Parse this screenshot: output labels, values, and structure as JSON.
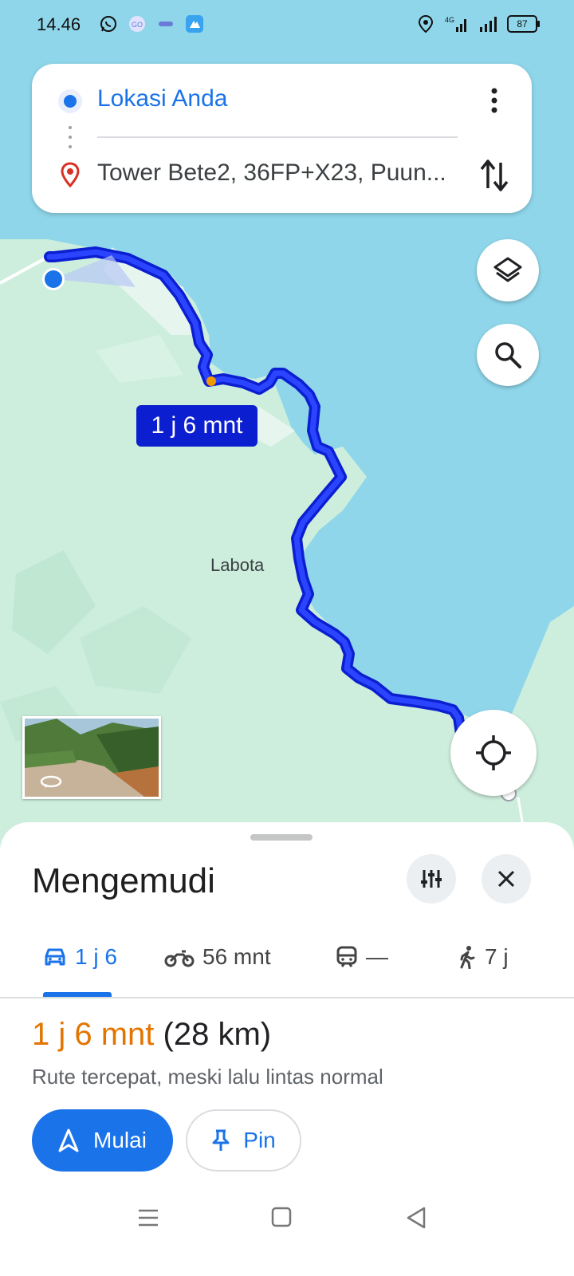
{
  "status_bar": {
    "time": "14.46",
    "battery": "87",
    "network": "4G",
    "left_icons": [
      "whatsapp-icon",
      "gojek-icon",
      "app-icon",
      "app-icon"
    ],
    "right_icons": [
      "location-icon",
      "signal-icon",
      "signal-icon",
      "battery-icon"
    ]
  },
  "directions": {
    "origin": "Lokasi Anda",
    "destination": "Tower Bete2, 36FP+X23, Puun..."
  },
  "map": {
    "route_time_label": "1 j 6 mnt",
    "place_label": "Labota",
    "colors": {
      "water": "#8fd6ea",
      "land": "#cdeedd",
      "route": "#0b1fd0",
      "current_location": "#1a73e8"
    }
  },
  "sheet": {
    "title": "Mengemudi",
    "tabs": [
      {
        "icon": "car-icon",
        "label": "1 j 6",
        "active": true
      },
      {
        "icon": "motorcycle-icon",
        "label": "56 mnt",
        "active": false
      },
      {
        "icon": "train-icon",
        "label": "—",
        "active": false
      },
      {
        "icon": "walk-icon",
        "label": "7 j",
        "active": false
      }
    ],
    "summary_duration": "1 j 6 mnt",
    "summary_distance": "(28 km)",
    "summary_note": "Rute tercepat, meski lalu lintas normal",
    "start_label": "Mulai",
    "pin_label": "Pin"
  }
}
